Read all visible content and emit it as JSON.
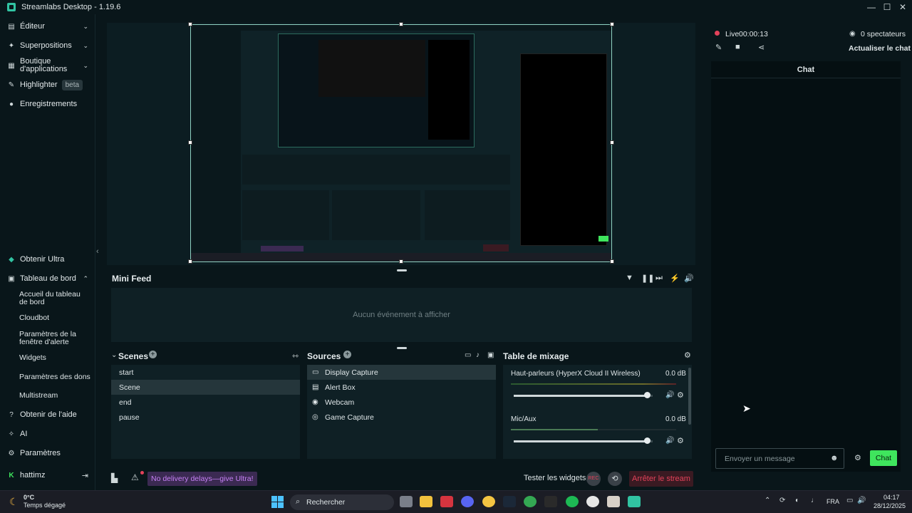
{
  "window": {
    "title": "Streamlabs Desktop - 1.19.6",
    "minimize": "—",
    "maximize": "☐",
    "close": "✕"
  },
  "sidebar": {
    "top_items": [
      {
        "label": "Éditeur",
        "icon": "editor-icon",
        "has_chevron": true
      },
      {
        "label": "Superpositions",
        "icon": "overlays-icon",
        "has_chevron": true
      },
      {
        "label": "Boutique d'applications",
        "icon": "app-store-icon",
        "has_chevron": true
      },
      {
        "label": "Highlighter",
        "icon": "highlighter-icon",
        "badge": "beta"
      },
      {
        "label": "Enregistrements",
        "icon": "recordings-icon"
      }
    ],
    "get_ultra": "Obtenir Ultra",
    "dashboard": "Tableau de bord",
    "dashboard_sub": [
      "Accueil du tableau de bord",
      "Cloudbot",
      "Paramètres de la fenêtre d'alerte",
      "Widgets",
      "Paramètres des dons",
      "Multistream"
    ],
    "help": "Obtenir de l'aide",
    "ai": "AI",
    "settings": "Paramètres",
    "user": "hattimz"
  },
  "mini_feed": {
    "title": "Mini Feed",
    "empty": "Aucun événement à afficher"
  },
  "scenes": {
    "title": "Scenes",
    "items": [
      "start",
      "Scene",
      "end",
      "pause"
    ],
    "selected": "Scene"
  },
  "sources": {
    "title": "Sources",
    "items": [
      {
        "label": "Display Capture",
        "icon": "monitor-icon"
      },
      {
        "label": "Alert Box",
        "icon": "alert-box-icon"
      },
      {
        "label": "Webcam",
        "icon": "webcam-icon"
      },
      {
        "label": "Game Capture",
        "icon": "gamepad-icon"
      }
    ],
    "selected": "Display Capture"
  },
  "mixer": {
    "title": "Table de mixage",
    "channels": [
      {
        "name": "Haut-parleurs (HyperX Cloud II Wireless)",
        "db": "0.0 dB",
        "level": 0.96
      },
      {
        "name": "Mic/Aux",
        "db": "0.0 dB",
        "level": 0.96
      }
    ]
  },
  "bottom": {
    "promo": "No delivery delays—give Ultra!",
    "test_widgets": "Tester les widgets",
    "stop_stream": "Arrêter le stream"
  },
  "chat": {
    "live": "Live",
    "timer": "00:00:13",
    "viewers": "0 spectateurs",
    "refresh": "Actualiser le chat",
    "title": "Chat",
    "placeholder": "Envoyer un message",
    "send": "Chat"
  },
  "taskbar": {
    "weather_temp": "0°C",
    "weather_desc": "Temps dégagé",
    "search": "Rechercher",
    "lang": "FRA",
    "time": "04:17",
    "date": "28/12/2025"
  },
  "colors": {
    "accent": "#31c3a2",
    "chat_button": "#3fe55d",
    "stop": "#e3425a",
    "live_dot": "#e3425a",
    "promo": "#c680f5"
  }
}
